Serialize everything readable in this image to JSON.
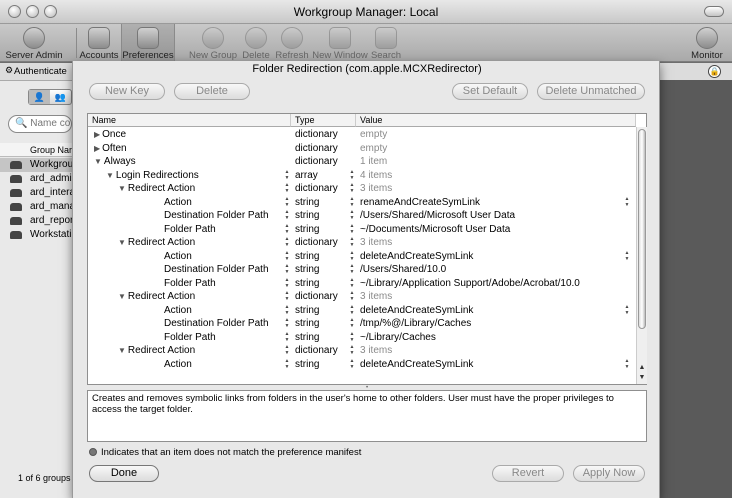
{
  "window": {
    "title": "Workgroup Manager: Local"
  },
  "toolbar": {
    "items": [
      {
        "label": "Server Admin",
        "icon": "server-admin-icon"
      },
      {
        "label": "Accounts",
        "icon": "accounts-icon"
      },
      {
        "label": "Preferences",
        "icon": "preferences-icon"
      },
      {
        "label": "New Group",
        "icon": "new-group-icon"
      },
      {
        "label": "Delete",
        "icon": "delete-icon"
      },
      {
        "label": "Refresh",
        "icon": "refresh-icon"
      },
      {
        "label": "New Window",
        "icon": "new-window-icon"
      },
      {
        "label": "Search",
        "icon": "search-icon"
      },
      {
        "label": "Monitor",
        "icon": "monitor-icon"
      }
    ]
  },
  "auth": {
    "text": "Authenticate"
  },
  "left": {
    "search_placeholder": "Name co",
    "column_header": "Group Nar",
    "groups": [
      "Workgrou",
      "ard_admi",
      "ard_intera",
      "ard_mana",
      "ard_repor",
      "Workstati"
    ],
    "count": "1 of 6 groups"
  },
  "sheet": {
    "title": "Folder Redirection (com.apple.MCXRedirector)",
    "buttons": {
      "new_key": "New Key",
      "delete": "Delete",
      "set_default": "Set Default",
      "delete_unmatched": "Delete Unmatched",
      "done": "Done",
      "revert": "Revert",
      "apply_now": "Apply Now"
    },
    "columns": {
      "name": "Name",
      "type": "Type",
      "value": "Value"
    },
    "rows": [
      {
        "name": "Once",
        "type": "dictionary",
        "value": "empty",
        "tri": "▶",
        "indent": 0,
        "grey": true,
        "stepper_type": false,
        "stepper_val": false,
        "pop": false
      },
      {
        "name": "Often",
        "type": "dictionary",
        "value": "empty",
        "tri": "▶",
        "indent": 0,
        "grey": true,
        "stepper_type": false,
        "stepper_val": false,
        "pop": false
      },
      {
        "name": "Always",
        "type": "dictionary",
        "value": "1 item",
        "tri": "▼",
        "indent": 0,
        "grey": true,
        "stepper_type": false,
        "stepper_val": false,
        "pop": false
      },
      {
        "name": "Login Redirections",
        "type": "array",
        "value": "4 items",
        "tri": "▼",
        "indent": 1,
        "grey": true,
        "stepper_type": true,
        "stepper_val": true,
        "pop": false
      },
      {
        "name": "Redirect Action",
        "type": "dictionary",
        "value": "3 items",
        "tri": "▼",
        "indent": 2,
        "grey": true,
        "stepper_type": true,
        "stepper_val": true,
        "pop": false
      },
      {
        "name": "Action",
        "type": "string",
        "value": "renameAndCreateSymLink",
        "tri": "",
        "indent": 3,
        "grey": false,
        "stepper_type": true,
        "stepper_val": true,
        "pop": true
      },
      {
        "name": "Destination Folder Path",
        "type": "string",
        "value": "/Users/Shared/Microsoft User Data",
        "tri": "",
        "indent": 3,
        "grey": false,
        "stepper_type": true,
        "stepper_val": true,
        "pop": false
      },
      {
        "name": "Folder Path",
        "type": "string",
        "value": "~/Documents/Microsoft User Data",
        "tri": "",
        "indent": 3,
        "grey": false,
        "stepper_type": true,
        "stepper_val": true,
        "pop": false
      },
      {
        "name": "Redirect Action",
        "type": "dictionary",
        "value": "3 items",
        "tri": "▼",
        "indent": 2,
        "grey": true,
        "stepper_type": true,
        "stepper_val": true,
        "pop": false
      },
      {
        "name": "Action",
        "type": "string",
        "value": "deleteAndCreateSymLink",
        "tri": "",
        "indent": 3,
        "grey": false,
        "stepper_type": true,
        "stepper_val": true,
        "pop": true
      },
      {
        "name": "Destination Folder Path",
        "type": "string",
        "value": "/Users/Shared/10.0",
        "tri": "",
        "indent": 3,
        "grey": false,
        "stepper_type": true,
        "stepper_val": true,
        "pop": false
      },
      {
        "name": "Folder Path",
        "type": "string",
        "value": "~/Library/Application Support/Adobe/Acrobat/10.0",
        "tri": "",
        "indent": 3,
        "grey": false,
        "stepper_type": true,
        "stepper_val": true,
        "pop": false
      },
      {
        "name": "Redirect Action",
        "type": "dictionary",
        "value": "3 items",
        "tri": "▼",
        "indent": 2,
        "grey": true,
        "stepper_type": true,
        "stepper_val": true,
        "pop": false
      },
      {
        "name": "Action",
        "type": "string",
        "value": "deleteAndCreateSymLink",
        "tri": "",
        "indent": 3,
        "grey": false,
        "stepper_type": true,
        "stepper_val": true,
        "pop": true
      },
      {
        "name": "Destination Folder Path",
        "type": "string",
        "value": "/tmp/%@/Library/Caches",
        "tri": "",
        "indent": 3,
        "grey": false,
        "stepper_type": true,
        "stepper_val": true,
        "pop": false
      },
      {
        "name": "Folder Path",
        "type": "string",
        "value": "~/Library/Caches",
        "tri": "",
        "indent": 3,
        "grey": false,
        "stepper_type": true,
        "stepper_val": true,
        "pop": false
      },
      {
        "name": "Redirect Action",
        "type": "dictionary",
        "value": "3 items",
        "tri": "▼",
        "indent": 2,
        "grey": true,
        "stepper_type": true,
        "stepper_val": true,
        "pop": false
      },
      {
        "name": "Action",
        "type": "string",
        "value": "deleteAndCreateSymLink",
        "tri": "",
        "indent": 3,
        "grey": false,
        "stepper_type": true,
        "stepper_val": true,
        "pop": true
      }
    ],
    "description": "Creates and removes symbolic links from folders in the user's home to other folders. User must have the proper privileges to access the target folder.",
    "legend": "Indicates that an item does not match the preference manifest"
  }
}
